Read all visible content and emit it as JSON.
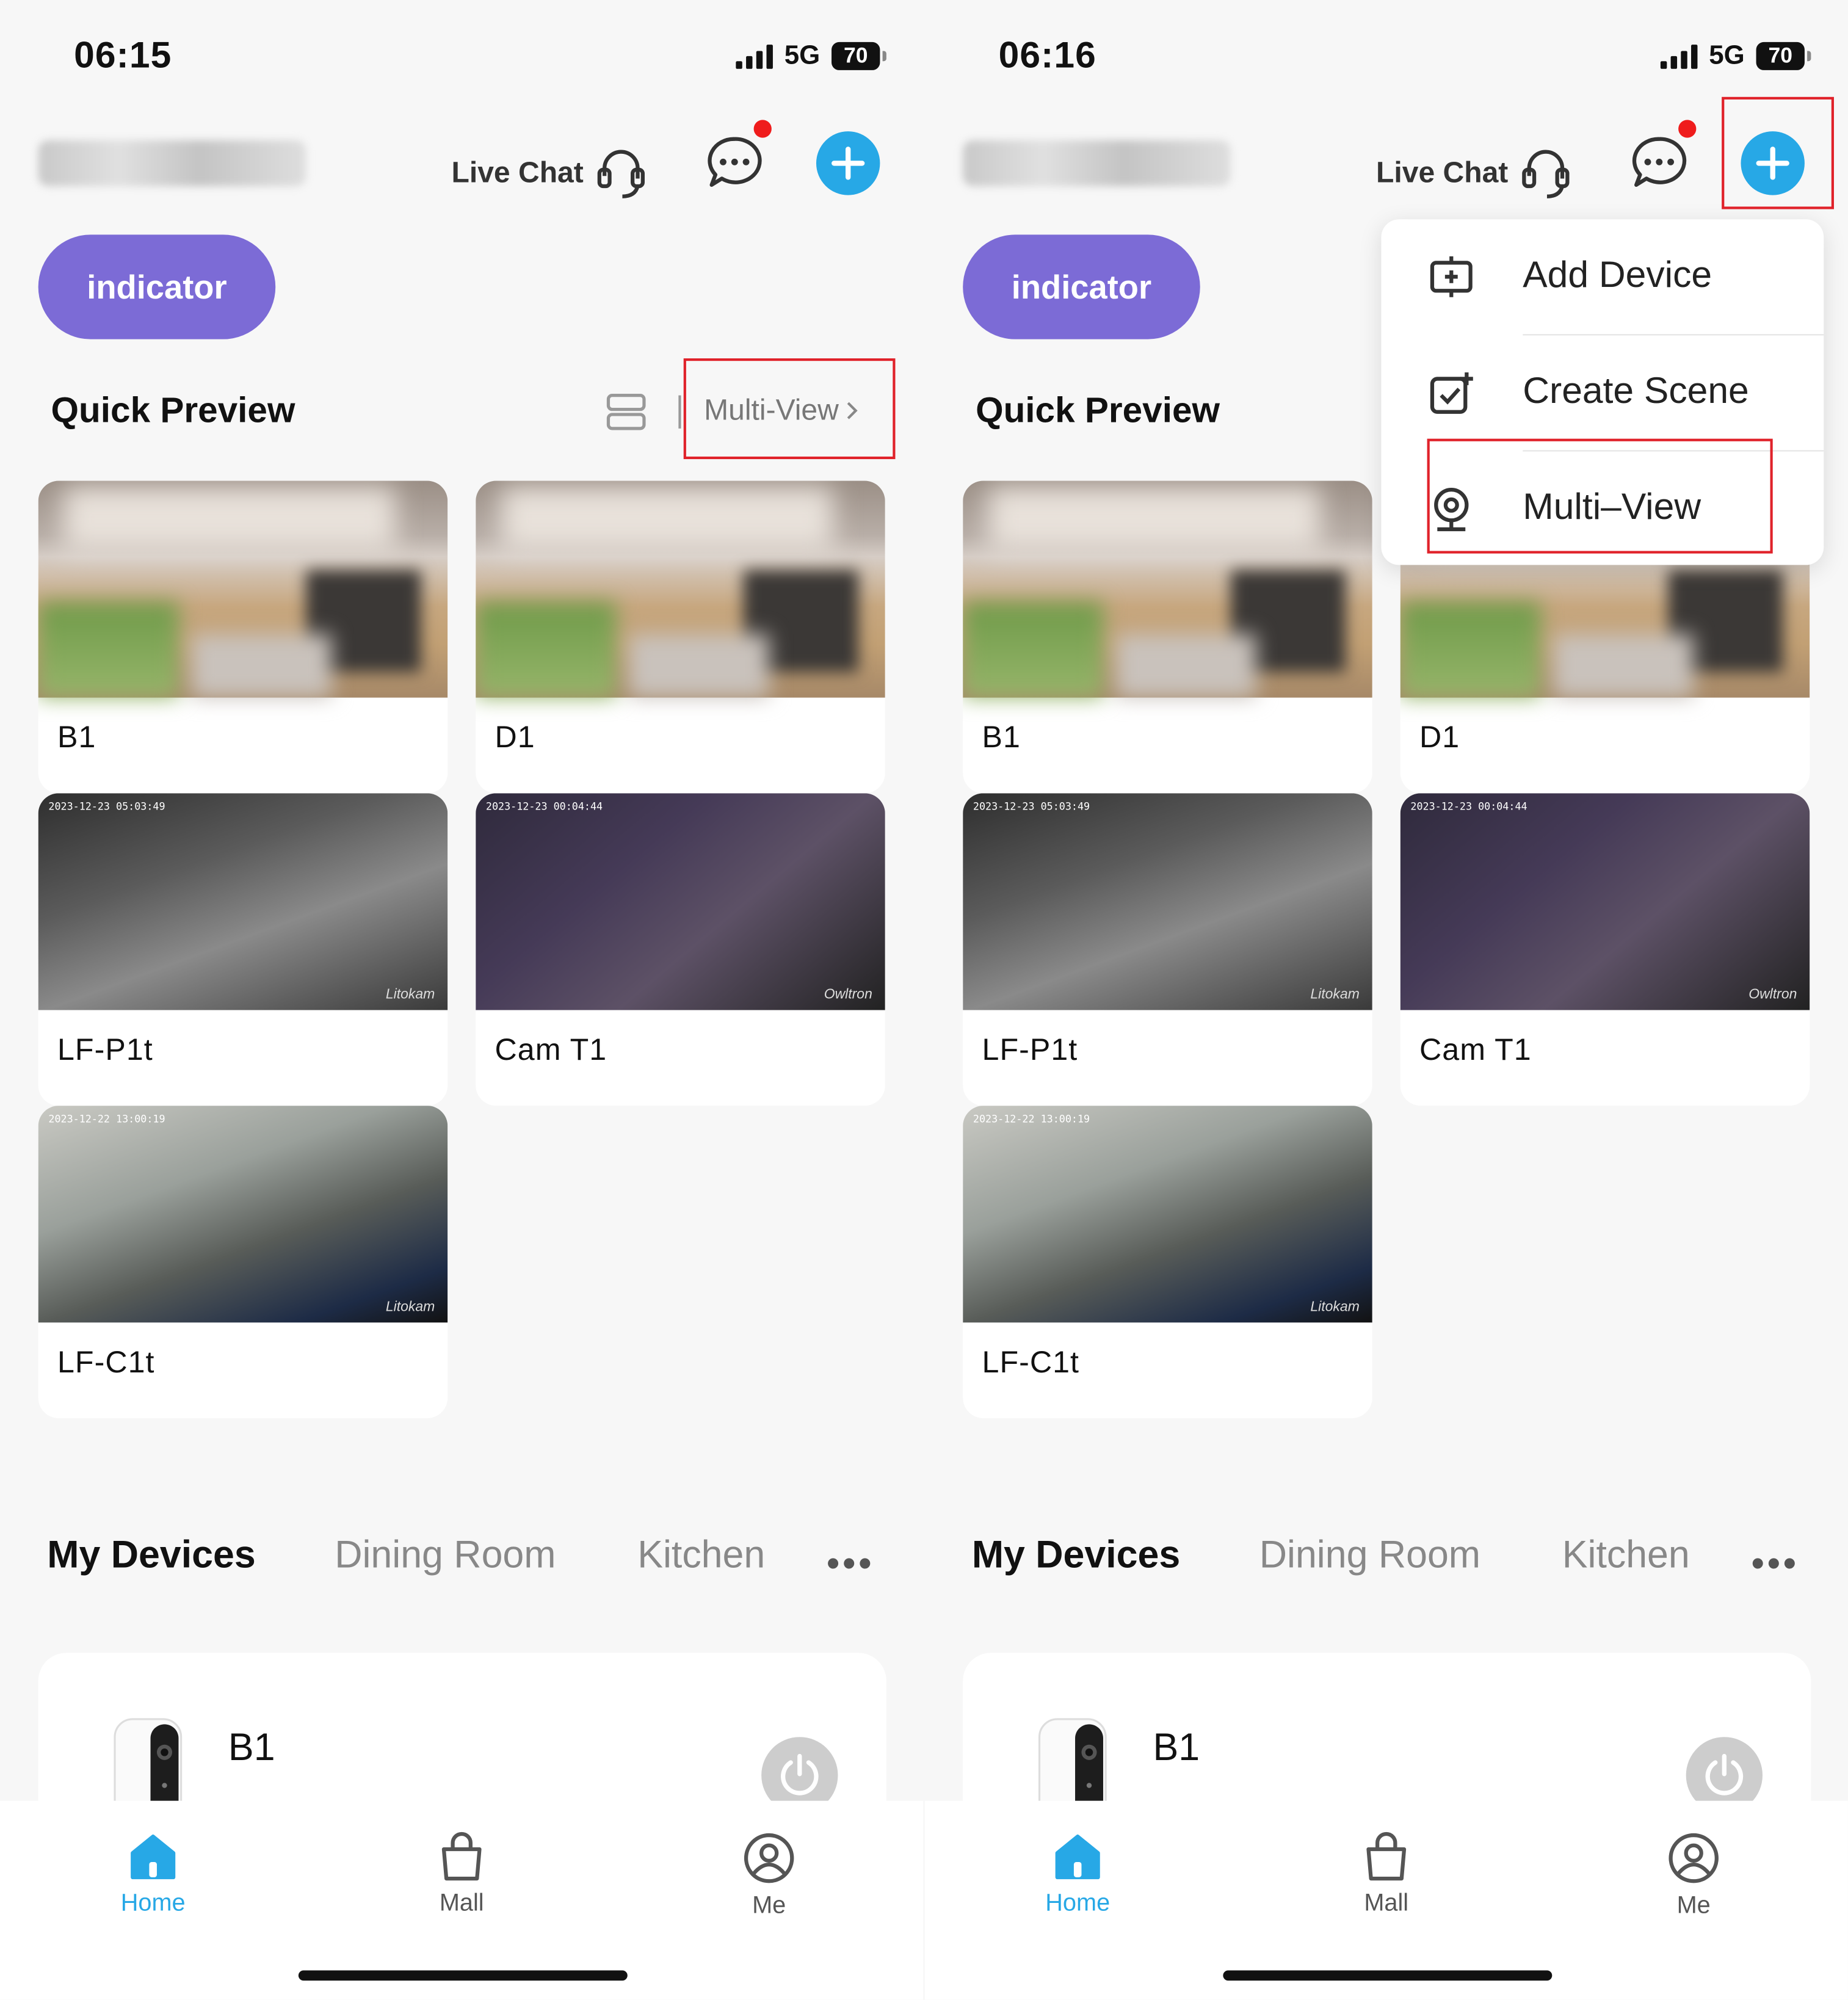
{
  "colors": {
    "accent": "#27a8e6",
    "indicator": "#7c6bd6",
    "notification": "#ef1c1c",
    "highlight": "#e0222a"
  },
  "screens": [
    {
      "status": {
        "time": "06:15",
        "network": "5G",
        "battery": "70"
      },
      "header": {
        "home_name": "Littlelf Smart",
        "live_chat": "Live Chat"
      },
      "indicator": "indicator",
      "quick_preview": {
        "title": "Quick Preview",
        "multi_view": "Multi-View",
        "cameras": [
          {
            "name": "B1"
          },
          {
            "name": "D1"
          },
          {
            "name": "LF-P1t",
            "timestamp": "2023-12-23 05:03:49",
            "brand": "Litokam"
          },
          {
            "name": "Cam  T1",
            "timestamp": "2023-12-23 00:04:44",
            "brand": "Owltron"
          },
          {
            "name": "LF-C1t",
            "timestamp": "2023-12-22 13:00:19",
            "brand": "Litokam"
          }
        ]
      },
      "rooms": {
        "tabs": [
          "My Devices",
          "Dining Room",
          "Kitchen"
        ],
        "more": "•••"
      },
      "device": {
        "name": "B1"
      },
      "nav": [
        {
          "label": "Home",
          "icon": "home-icon"
        },
        {
          "label": "Mall",
          "icon": "bag-icon"
        },
        {
          "label": "Me",
          "icon": "user-icon"
        }
      ]
    },
    {
      "status": {
        "time": "06:16",
        "network": "5G",
        "battery": "70"
      },
      "header": {
        "home_name": "Littlelf Smart",
        "live_chat": "Live Chat"
      },
      "indicator": "indicator",
      "quick_preview": {
        "title": "Quick Preview",
        "cameras": [
          {
            "name": "B1"
          },
          {
            "name": "D1"
          },
          {
            "name": "LF-P1t",
            "timestamp": "2023-12-23 05:03:49",
            "brand": "Litokam"
          },
          {
            "name": "Cam  T1",
            "timestamp": "2023-12-23 00:04:44",
            "brand": "Owltron"
          },
          {
            "name": "LF-C1t",
            "timestamp": "2023-12-22 13:00:19",
            "brand": "Litokam"
          }
        ]
      },
      "rooms": {
        "tabs": [
          "My Devices",
          "Dining Room",
          "Kitchen"
        ],
        "more": "•••"
      },
      "device": {
        "name": "B1"
      },
      "nav": [
        {
          "label": "Home",
          "icon": "home-icon"
        },
        {
          "label": "Mall",
          "icon": "bag-icon"
        },
        {
          "label": "Me",
          "icon": "user-icon"
        }
      ],
      "add_menu": [
        {
          "label": "Add Device",
          "icon": "add-device-icon"
        },
        {
          "label": "Create Scene",
          "icon": "create-scene-icon"
        },
        {
          "label": "Multi–View",
          "icon": "webcam-icon"
        }
      ]
    }
  ]
}
